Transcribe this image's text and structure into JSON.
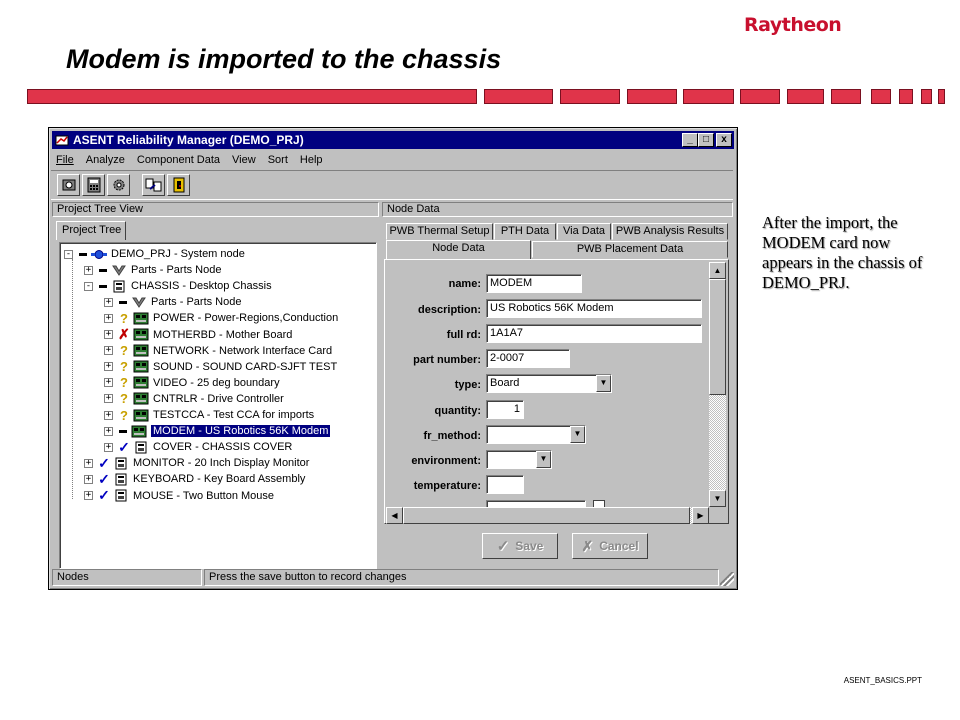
{
  "slide": {
    "logo": "Raytheon",
    "title": "Modem is imported to the chassis",
    "note": "After the import, the MODEM card now appears in the chassis of DEMO_PRJ.",
    "footer": "ASENT_BASICS.PPT"
  },
  "window": {
    "title": "ASENT Reliability Manager (DEMO_PRJ)",
    "controls": [
      "_",
      "□",
      "x"
    ]
  },
  "menu": [
    "File",
    "Analyze",
    "Component Data",
    "View",
    "Sort",
    "Help"
  ],
  "toolbar_icons": [
    "project-icon",
    "calculator-icon",
    "settings-icon",
    "import-icon",
    "exit-icon"
  ],
  "left_panel": {
    "header": "Project Tree View",
    "tab": "Project Tree"
  },
  "tree": [
    {
      "name": "DEMO_PRJ  -  System node",
      "exp": "-",
      "mark": "",
      "icon": "system"
    },
    {
      "name": "Parts  -  Parts Node",
      "exp": "+",
      "mark": "",
      "icon": "parts"
    },
    {
      "name": "CHASSIS  -  Desktop Chassis",
      "exp": "-",
      "mark": "",
      "icon": "chassis"
    },
    {
      "name": "Parts  -  Parts Node",
      "exp": "+",
      "mark": "",
      "icon": "parts"
    },
    {
      "name": "POWER  -  Power-Regions,Conduction",
      "exp": "+",
      "mark": "?",
      "icon": "board"
    },
    {
      "name": "MOTHERBD  -  Mother Board",
      "exp": "+",
      "mark": "x",
      "icon": "board"
    },
    {
      "name": "NETWORK  -  Network Interface Card",
      "exp": "+",
      "mark": "?",
      "icon": "board"
    },
    {
      "name": "SOUND  -  SOUND CARD-SJFT TEST",
      "exp": "+",
      "mark": "?",
      "icon": "board"
    },
    {
      "name": "VIDEO  -  25 deg boundary",
      "exp": "+",
      "mark": "?",
      "icon": "board"
    },
    {
      "name": "CNTRLR  -  Drive Controller",
      "exp": "+",
      "mark": "?",
      "icon": "board"
    },
    {
      "name": "TESTCCA  -  Test CCA for imports",
      "exp": "+",
      "mark": "?",
      "icon": "board"
    },
    {
      "name": "MODEM  -  US Robotics 56K Modem",
      "exp": "+",
      "mark": "",
      "icon": "board",
      "selected": true
    },
    {
      "name": "COVER  -  CHASSIS COVER",
      "exp": "+",
      "mark": "chk",
      "icon": "chassis"
    },
    {
      "name": "MONITOR  -  20 Inch Display Monitor",
      "exp": "+",
      "mark": "chk",
      "icon": "chassis"
    },
    {
      "name": "KEYBOARD  -  Key Board Assembly",
      "exp": "+",
      "mark": "chk",
      "icon": "chassis"
    },
    {
      "name": "MOUSE  -  Two Button Mouse",
      "exp": "+",
      "mark": "chk",
      "icon": "chassis"
    }
  ],
  "right_panel": {
    "header": "Node Data",
    "tabs_row1": [
      "PWB Thermal Setup",
      "PTH Data",
      "Via Data",
      "PWB Analysis Results"
    ],
    "tabs_row2": [
      "Node Data",
      "PWB Placement Data"
    ]
  },
  "form": {
    "name_label": "name:",
    "name": "MODEM",
    "description_label": "description:",
    "description": "US Robotics 56K Modem",
    "full_rd_label": "full rd:",
    "full_rd": "1A1A7",
    "part_number_label": "part number:",
    "part_number": "2-0007",
    "type_label": "type:",
    "type": "Board",
    "quantity_label": "quantity:",
    "quantity": "1",
    "fr_method_label": "fr_method:",
    "fr_method": "",
    "environment_label": "environment:",
    "environment": "",
    "temperature_label": "temperature:",
    "temperature": ""
  },
  "buttons": {
    "save": "Save",
    "cancel": "Cancel"
  },
  "statusbar": {
    "left": "Nodes",
    "right": "Press the save button to record changes"
  }
}
